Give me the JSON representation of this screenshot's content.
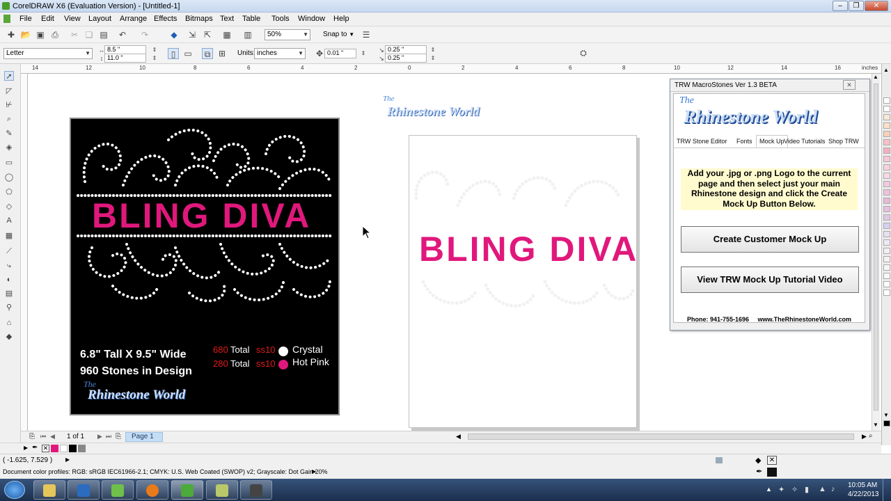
{
  "window": {
    "title": "CorelDRAW X6 (Evaluation Version) - [Untitled-1]"
  },
  "menu": [
    "File",
    "Edit",
    "View",
    "Layout",
    "Arrange",
    "Effects",
    "Bitmaps",
    "Text",
    "Table",
    "Tools",
    "Window",
    "Help"
  ],
  "toolbar": {
    "zoom": "50%",
    "snap": "Snap to"
  },
  "propbar": {
    "page_size": "Letter",
    "width": "8.5 \"",
    "height": "11.0 \"",
    "units_label": "Units:",
    "units": "inches",
    "nudge": "0.01 \"",
    "dup_x": "0.25 \"",
    "dup_y": "0.25 \""
  },
  "ruler": {
    "ticks": [
      "14",
      "12",
      "10",
      "8",
      "6",
      "4",
      "2",
      "0",
      "2",
      "4",
      "6",
      "8",
      "10",
      "12",
      "14",
      "16"
    ],
    "unit": "inches"
  },
  "design": {
    "title": "BLING DIVA",
    "size_line": "6.8\" Tall X 9.5\" Wide",
    "stones_line": "960 Stones in Design",
    "rows": [
      {
        "count": "680",
        "total": "Total",
        "size": "ss10",
        "color": "Crystal",
        "swatch": "#ffffff"
      },
      {
        "count": "280",
        "total": "Total",
        "size": "ss10",
        "color": "Hot Pink",
        "swatch": "#e0187c"
      }
    ],
    "brand_the": "The",
    "brand_name": "Rhinestone World"
  },
  "mockup": {
    "title": "BLING DIVA"
  },
  "canvas_logo": {
    "the": "The",
    "name": "Rhinestone World"
  },
  "dialog": {
    "title": "TRW MacroStones Ver 1.3 BETA",
    "close": "✕",
    "logo_the": "The",
    "logo_name": "Rhinestone World",
    "tabs": [
      "TRW Stone Editor",
      "Fonts",
      "Mock Up",
      "Video Tutorials",
      "Shop TRW"
    ],
    "active_tab": "Mock Up",
    "instructions": "Add your .jpg or .png Logo to the current page and then select just your main Rhinestone design and click the Create Mock Up Button Below.",
    "button_create": "Create Customer Mock Up",
    "button_video": "View TRW Mock Up Tutorial Video",
    "footer": "Phone: 941-755-1696     www.TheRhinestoneWorld.com"
  },
  "pages": {
    "indicator": "1 of 1",
    "tab": "Page 1"
  },
  "status": {
    "coords": "( -1.625, 7.529 )",
    "profiles": "Document color profiles: RGB: sRGB IEC61966-2.1; CMYK: U.S. Web Coated (SWOP) v2; Grayscale: Dot Gain 20%"
  },
  "clock": {
    "time": "10:05 AM",
    "date": "4/22/2013"
  },
  "colors": {
    "accent_pink": "#e0187c",
    "titlebar": "#c6d8ef",
    "taskbar": "#1b2f4d"
  }
}
